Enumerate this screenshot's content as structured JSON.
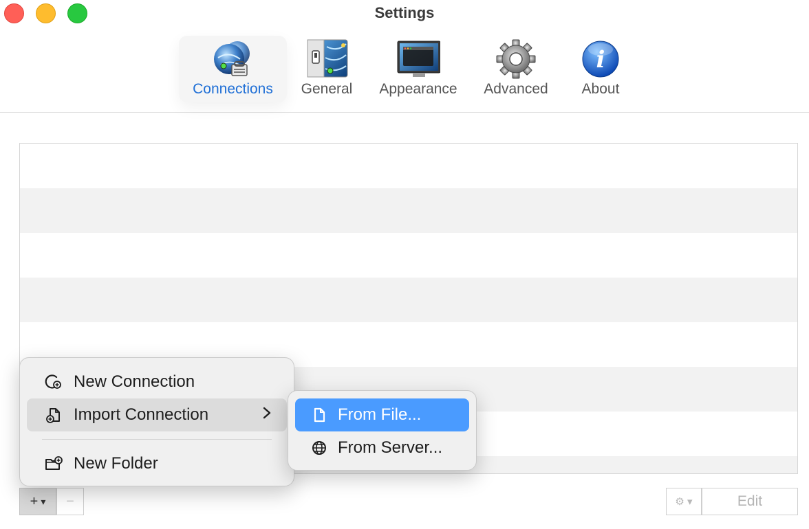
{
  "window": {
    "title": "Settings"
  },
  "toolbar": {
    "tabs": [
      {
        "label": "Connections",
        "icon": "connections-globe-icon",
        "selected": true
      },
      {
        "label": "General",
        "icon": "general-switch-icon",
        "selected": false
      },
      {
        "label": "Appearance",
        "icon": "appearance-monitor-icon",
        "selected": false
      },
      {
        "label": "Advanced",
        "icon": "gear-icon",
        "selected": false
      },
      {
        "label": "About",
        "icon": "info-icon",
        "selected": false
      }
    ]
  },
  "context_menu": {
    "items": [
      {
        "label": "New Connection",
        "icon": "new-connection-icon"
      },
      {
        "label": "Import Connection",
        "icon": "import-connection-icon",
        "submenu": true
      },
      {
        "label": "New Folder",
        "icon": "new-folder-icon"
      }
    ],
    "submenu": [
      {
        "label": "From File...",
        "icon": "file-icon",
        "selected": true
      },
      {
        "label": "From Server...",
        "icon": "globe-icon"
      }
    ]
  },
  "bottom_bar": {
    "add_label": "+",
    "add_dropdown": "▾",
    "remove_label": "−",
    "gear_label": "⚙ ▾",
    "edit_label": "Edit"
  },
  "colors": {
    "accent": "#1f6fd6",
    "menu_selected": "#4a9bff",
    "close": "#ff5f57",
    "minimize": "#febc2e",
    "maximize": "#28c840"
  }
}
